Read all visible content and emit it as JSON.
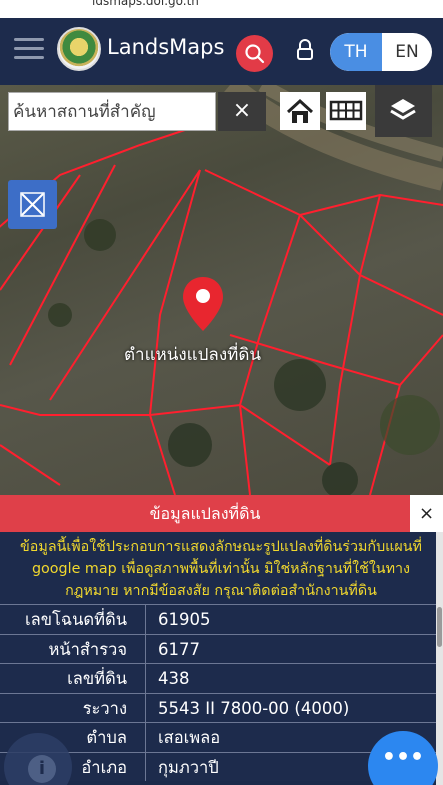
{
  "status_bar": {
    "url_fragment": "ldsmaps.dol.go.th"
  },
  "header": {
    "brand": "LandsMaps",
    "lang_th": "TH",
    "lang_en": "EN"
  },
  "map": {
    "search_placeholder": "ค้นหาสถานที่สำคัญ",
    "clear_label": "×",
    "pin_label": "ตำแหน่งแปลงที่ดิน"
  },
  "panel": {
    "title": "ข้อมูลแปลงที่ดิน",
    "close_label": "×",
    "notice": "ข้อมูลนี้เพื่อใช้ประกอบการแสดงลักษณะรูปแปลงที่ดินร่วมกับแผนที่ google map เพื่อดูสภาพพื้นที่เท่านั้น มิใช่หลักฐานที่ใช้ในทางกฎหมาย หากมีข้อสงสัย กรุณาติดต่อสำนักงานที่ดิน",
    "rows": [
      {
        "key": "เลขโฉนดที่ดิน",
        "value": "61905"
      },
      {
        "key": "หน้าสำรวจ",
        "value": "6177"
      },
      {
        "key": "เลขที่ดิน",
        "value": "438"
      },
      {
        "key": "ระวาง",
        "value": "5543 II 7800-00 (4000)"
      },
      {
        "key": "ตำบล",
        "value": "เสอเพลอ"
      },
      {
        "key": "อำเภอ",
        "value": "กุมภวาปี"
      }
    ]
  },
  "fabs": {
    "info_label": "i",
    "chat_label": "•••"
  },
  "colors": {
    "header_bg": "#1d2b4c",
    "accent_red": "#df4049",
    "lang_active": "#4a8ee3",
    "notice_text": "#f1d82e",
    "chat_fab": "#2c87f0"
  },
  "icons": [
    "hamburger-icon",
    "search-icon",
    "lock-icon",
    "home-icon",
    "grid-icon",
    "layers-icon",
    "measure-icon",
    "location-pin-icon",
    "close-icon",
    "info-icon",
    "chat-icon"
  ]
}
